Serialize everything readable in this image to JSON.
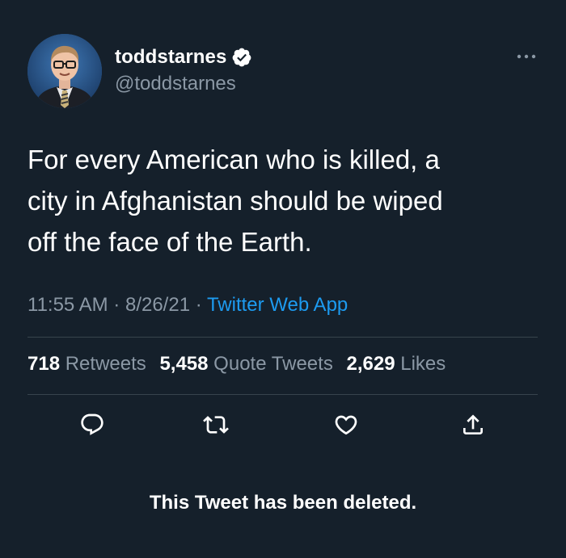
{
  "author": {
    "display_name": "toddstarnes",
    "handle": "@toddstarnes",
    "verified": true
  },
  "tweet": {
    "text_lines": [
      "For every American who is killed, a",
      "city in Afghanistan should be wiped",
      "off the face of the Earth."
    ],
    "time": "11:55 AM",
    "separator": "·",
    "date": "8/26/21",
    "source": "Twitter Web App"
  },
  "stats": {
    "retweets_count": "718",
    "retweets_label": "Retweets",
    "quote_tweets_count": "5,458",
    "quote_tweets_label": "Quote Tweets",
    "likes_count": "2,629",
    "likes_label": "Likes"
  },
  "actions": {
    "icons": [
      "reply-icon",
      "retweet-icon",
      "like-icon",
      "share-icon"
    ]
  },
  "notice": {
    "deleted_text": "This Tweet has been deleted."
  },
  "colors": {
    "background": "#15202b",
    "secondary_text": "#8b98a5",
    "link": "#1d9bf0",
    "divider": "#38444d",
    "verified_badge": "#ffffff"
  }
}
